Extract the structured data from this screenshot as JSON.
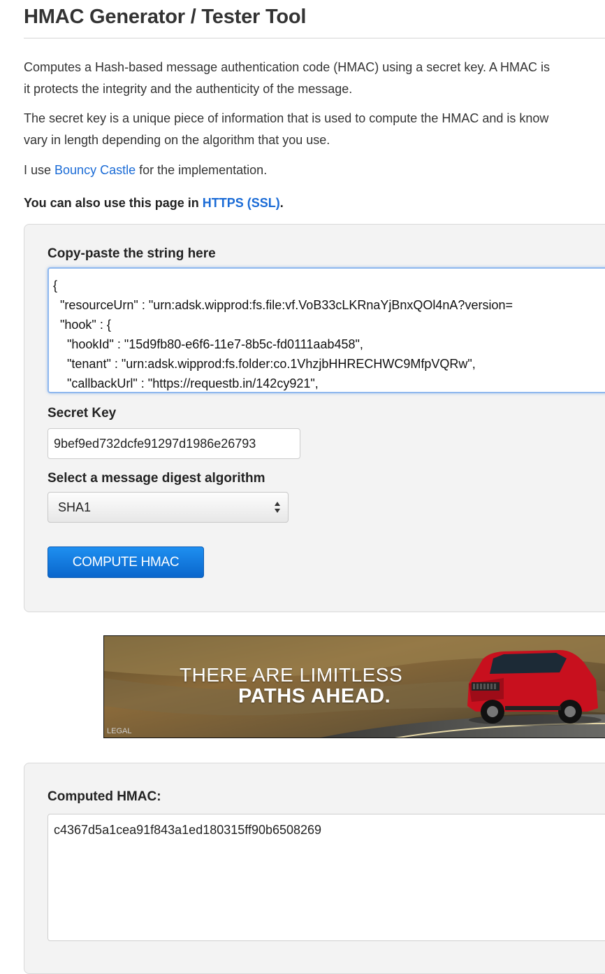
{
  "page": {
    "title": "HMAC Generator / Tester Tool"
  },
  "intro": {
    "p1_line1": "Computes a Hash-based message authentication code (HMAC) using a secret key. A HMAC is",
    "p1_line2": "it protects the integrity and the authenticity of the message.",
    "p2_line1": "The secret key is a unique piece of information that is used to compute the HMAC and is know",
    "p2_line2": "vary in length depending on the algorithm that you use.",
    "p3_prefix": "I use ",
    "p3_link": "Bouncy Castle",
    "p3_suffix": " for the implementation.",
    "ssl_prefix": "You can also use this page in ",
    "ssl_link": "HTTPS (SSL)",
    "ssl_suffix": "."
  },
  "form": {
    "string_label": "Copy-paste the string here",
    "string_value": "{\n  \"resourceUrn\" : \"urn:adsk.wipprod:fs.file:vf.VoB33cLKRnaYjBnxQOl4nA?version=\n  \"hook\" : {\n    \"hookId\" : \"15d9fb80-e6f6-11e7-8b5c-fd0111aab458\",\n    \"tenant\" : \"urn:adsk.wipprod:fs.folder:co.1VhzjbHHRECHWC9MfpVQRw\",\n    \"callbackUrl\" : \"https://requestb.in/142cy921\",",
    "secret_label": "Secret Key",
    "secret_value": "9bef9ed732dcfe91297d1986e26793",
    "algorithm_label": "Select a message digest algorithm",
    "algorithm_selected": "SHA1",
    "compute_button": "COMPUTE HMAC"
  },
  "ad": {
    "line1": "THERE ARE LIMITLESS",
    "line2": "PATHS AHEAD.",
    "legal": "LEGAL"
  },
  "result": {
    "label": "Computed HMAC:",
    "value": "c4367d5a1cea91f843a1ed180315ff90b6508269"
  },
  "colors": {
    "link": "#1a6bd6",
    "button": "#0a66cc",
    "panel": "#f3f3f3"
  }
}
